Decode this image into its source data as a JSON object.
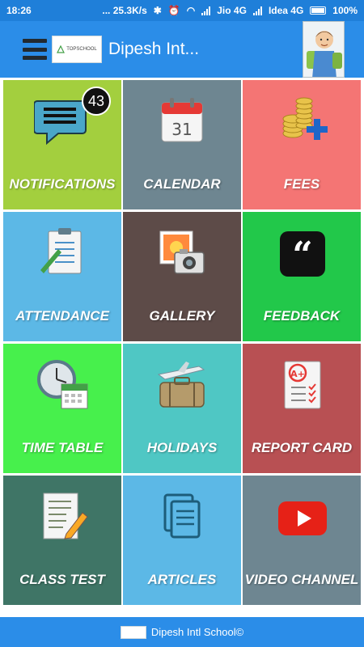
{
  "status_bar": {
    "time": "18:26",
    "data_speed": "25.3K/s",
    "carrier1": "Jio 4G",
    "carrier2": "Idea 4G",
    "battery": "100%"
  },
  "header": {
    "logo_text": "TOPSCHOOL",
    "title": "Dipesh Int..."
  },
  "colors": {
    "app_bar": "#2b8de8",
    "status_bar": "#1f7fd9"
  },
  "tiles": [
    {
      "label": "NOTIFICATIONS",
      "icon": "notifications-icon",
      "color": "#a3cf3e",
      "badge": "43"
    },
    {
      "label": "CALENDAR",
      "icon": "calendar-icon",
      "color": "#6e8691"
    },
    {
      "label": "FEES",
      "icon": "fees-icon",
      "color": "#f47574"
    },
    {
      "label": "ATTENDANCE",
      "icon": "attendance-icon",
      "color": "#5cb8e6"
    },
    {
      "label": "GALLERY",
      "icon": "gallery-icon",
      "color": "#5d4b48"
    },
    {
      "label": "FEEDBACK",
      "icon": "feedback-icon",
      "color": "#22c84a"
    },
    {
      "label": "TIME TABLE",
      "icon": "timetable-icon",
      "color": "#47f04c"
    },
    {
      "label": "HOLIDAYS",
      "icon": "holidays-icon",
      "color": "#4fc7c4"
    },
    {
      "label": "REPORT CARD",
      "icon": "report-card-icon",
      "color": "#b85053"
    },
    {
      "label": "CLASS TEST",
      "icon": "class-test-icon",
      "color": "#3f7566"
    },
    {
      "label": "ARTICLES",
      "icon": "articles-icon",
      "color": "#5cb8e6"
    },
    {
      "label": "VIDEO CHANNEL",
      "icon": "video-channel-icon",
      "color": "#6e8691"
    }
  ],
  "calendar_day": "31",
  "footer": {
    "text": "Dipesh Intl School©"
  }
}
